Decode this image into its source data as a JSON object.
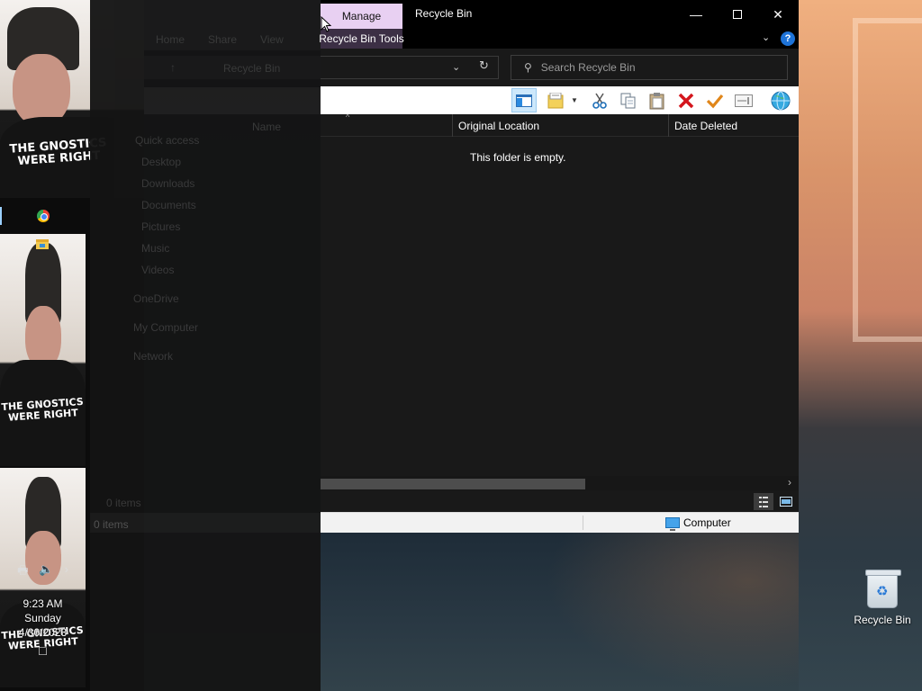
{
  "window": {
    "title": "Recycle Bin",
    "context_tab": "Manage",
    "context_group": "Recycle Bin Tools",
    "help_label": "?"
  },
  "faded_explorer": {
    "ribbon_tabs": [
      "Home",
      "Share",
      "View"
    ],
    "address_text": "Recycle Bin",
    "nav_items": [
      "Quick access",
      "Desktop",
      "Downloads",
      "Documents",
      "Pictures",
      "Music",
      "Videos",
      "OneDrive",
      "My Computer",
      "Network"
    ],
    "column_name": "Name",
    "items_count": "0 items"
  },
  "search": {
    "placeholder": "Search Recycle Bin"
  },
  "columns": [
    "Original Location",
    "Date Deleted"
  ],
  "empty_message": "This folder is empty.",
  "status": {
    "items": "0 items",
    "zone": "Computer"
  },
  "taskbar": {
    "time": "9:23 AM",
    "day": "Sunday",
    "date": "4/30/2023"
  },
  "desktop": {
    "icons": [
      {
        "label": "Recycle Bin"
      }
    ]
  },
  "webcam": {
    "shirt_text": "THE GNOSTICS WERE RIGHT"
  },
  "colors": {
    "context_tab_bg": "#e8d0f2",
    "window_bg": "#191919",
    "accent_blue": "#1e73d8"
  }
}
